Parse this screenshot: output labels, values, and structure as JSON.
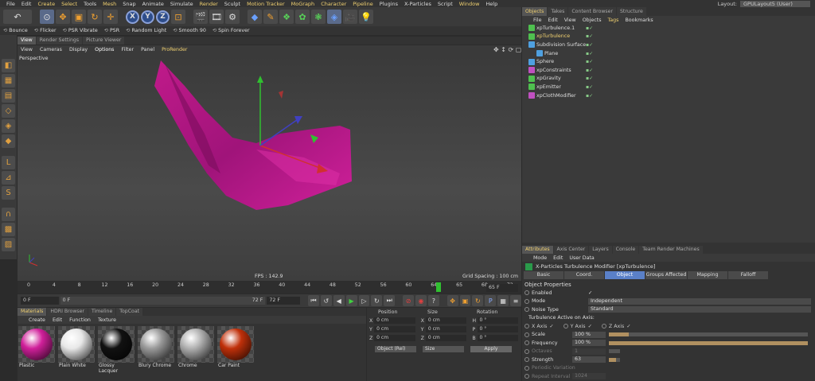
{
  "menubar": {
    "items": [
      "File",
      "Edit",
      "Create",
      "Select",
      "Tools",
      "Mesh",
      "Snap",
      "Animate",
      "Simulate",
      "Render",
      "Sculpt",
      "Motion Tracker",
      "MoGraph",
      "Character",
      "Pipeline",
      "Plugins",
      "X-Particles",
      "Script",
      "Window",
      "Help"
    ],
    "layout_label": "Layout:",
    "layout_value": "GPULayout5 (User)"
  },
  "simbar": {
    "items": [
      "Bounce",
      "Flicker",
      "PSR Vibrate",
      "PSR",
      "Random Light",
      "Smooth 90",
      "Spin Forever"
    ]
  },
  "viewport": {
    "tabs": [
      "View",
      "Render Settings",
      "Picture Viewer"
    ],
    "menu": [
      "View",
      "Cameras",
      "Display",
      "Options",
      "Filter",
      "Panel",
      "ProRender"
    ],
    "label": "Perspective",
    "fps": "FPS : 142.9",
    "grid": "Grid Spacing : 100 cm"
  },
  "timeline": {
    "ticks": [
      "0",
      "4",
      "8",
      "12",
      "16",
      "20",
      "24",
      "28",
      "32",
      "36",
      "40",
      "44",
      "48",
      "52",
      "56",
      "60",
      "64",
      "65",
      "68",
      "72"
    ],
    "end_field": "65 F",
    "start": "0 F",
    "current": "0 F",
    "preview_end": "72 F",
    "end": "72 F"
  },
  "materials": {
    "tabs": [
      "Materials",
      "HDRI Browser",
      "Timeline",
      "TopCoat"
    ],
    "menu": [
      "Create",
      "Edit",
      "Function",
      "Texture"
    ],
    "items": [
      {
        "name": "Plastic",
        "color": "#d0209a"
      },
      {
        "name": "Plain White",
        "color": "#e8e8e8"
      },
      {
        "name": "Glossy Lacquer",
        "color": "#111111"
      },
      {
        "name": "Blury Chrome",
        "color": "#9a9a9a"
      },
      {
        "name": "Chrome",
        "color": "#b0b0b0"
      },
      {
        "name": "Car Paint",
        "color": "#c0300a"
      }
    ]
  },
  "coords": {
    "headers": [
      "Position",
      "Size",
      "Rotation"
    ],
    "rows": [
      {
        "axis": "X",
        "pos": "0 cm",
        "size": "0 cm",
        "rot_axis": "H",
        "rot": "0 °"
      },
      {
        "axis": "Y",
        "pos": "0 cm",
        "size": "0 cm",
        "rot_axis": "P",
        "rot": "0 °"
      },
      {
        "axis": "Z",
        "pos": "0 cm",
        "size": "0 cm",
        "rot_axis": "B",
        "rot": "0 °"
      }
    ],
    "mode": "Object (Rel)",
    "size_mode": "Size",
    "apply": "Apply"
  },
  "objects": {
    "tabs": [
      "Objects",
      "Takes",
      "Content Browser",
      "Structure"
    ],
    "menu": [
      "File",
      "Edit",
      "View",
      "Objects",
      "Tags",
      "Bookmarks"
    ],
    "items": [
      {
        "name": "xpTurbulence.1",
        "color": "#4fc04f"
      },
      {
        "name": "xpTurbulence",
        "color": "#4fc04f",
        "selected": true
      },
      {
        "name": "Subdivision Surface",
        "color": "#4fa0e0"
      },
      {
        "name": "Plane",
        "color": "#4fa0e0"
      },
      {
        "name": "Sphere",
        "color": "#4fa0e0"
      },
      {
        "name": "xpConstraints",
        "color": "#c050c0"
      },
      {
        "name": "xpGravity",
        "color": "#4fc04f"
      },
      {
        "name": "xpEmitter",
        "color": "#4fc04f"
      },
      {
        "name": "xpClothModifier",
        "color": "#c050c0"
      }
    ]
  },
  "attributes": {
    "tabs": [
      "Attributes",
      "Axis Center",
      "Layers",
      "Console",
      "Team Render Machines"
    ],
    "menu": [
      "Mode",
      "Edit",
      "User Data"
    ],
    "title": "X-Particles Turbulence Modifier [xpTurbulence]",
    "subtabs": [
      "Basic",
      "Coord.",
      "Object",
      "Groups Affected",
      "Mapping",
      "Falloff"
    ],
    "section": "Object Properties",
    "enabled_label": "Enabled",
    "mode_label": "Mode",
    "mode_value": "Independent",
    "noise_label": "Noise Type",
    "noise_value": "Standard",
    "axis_label": "Turbulence Active on Axis:",
    "x_axis": "X Axis",
    "y_axis": "Y Axis",
    "z_axis": "Z Axis",
    "scale_label": "Scale",
    "scale_value": "100 %",
    "freq_label": "Frequency",
    "freq_value": "100 %",
    "octaves_label": "Octaves",
    "octaves_value": "1",
    "strength_label": "Strength",
    "strength_value": "63",
    "periodic_label": "Periodic Variation",
    "repeat_label": "Repeat Interval",
    "repeat_value": "1024"
  }
}
